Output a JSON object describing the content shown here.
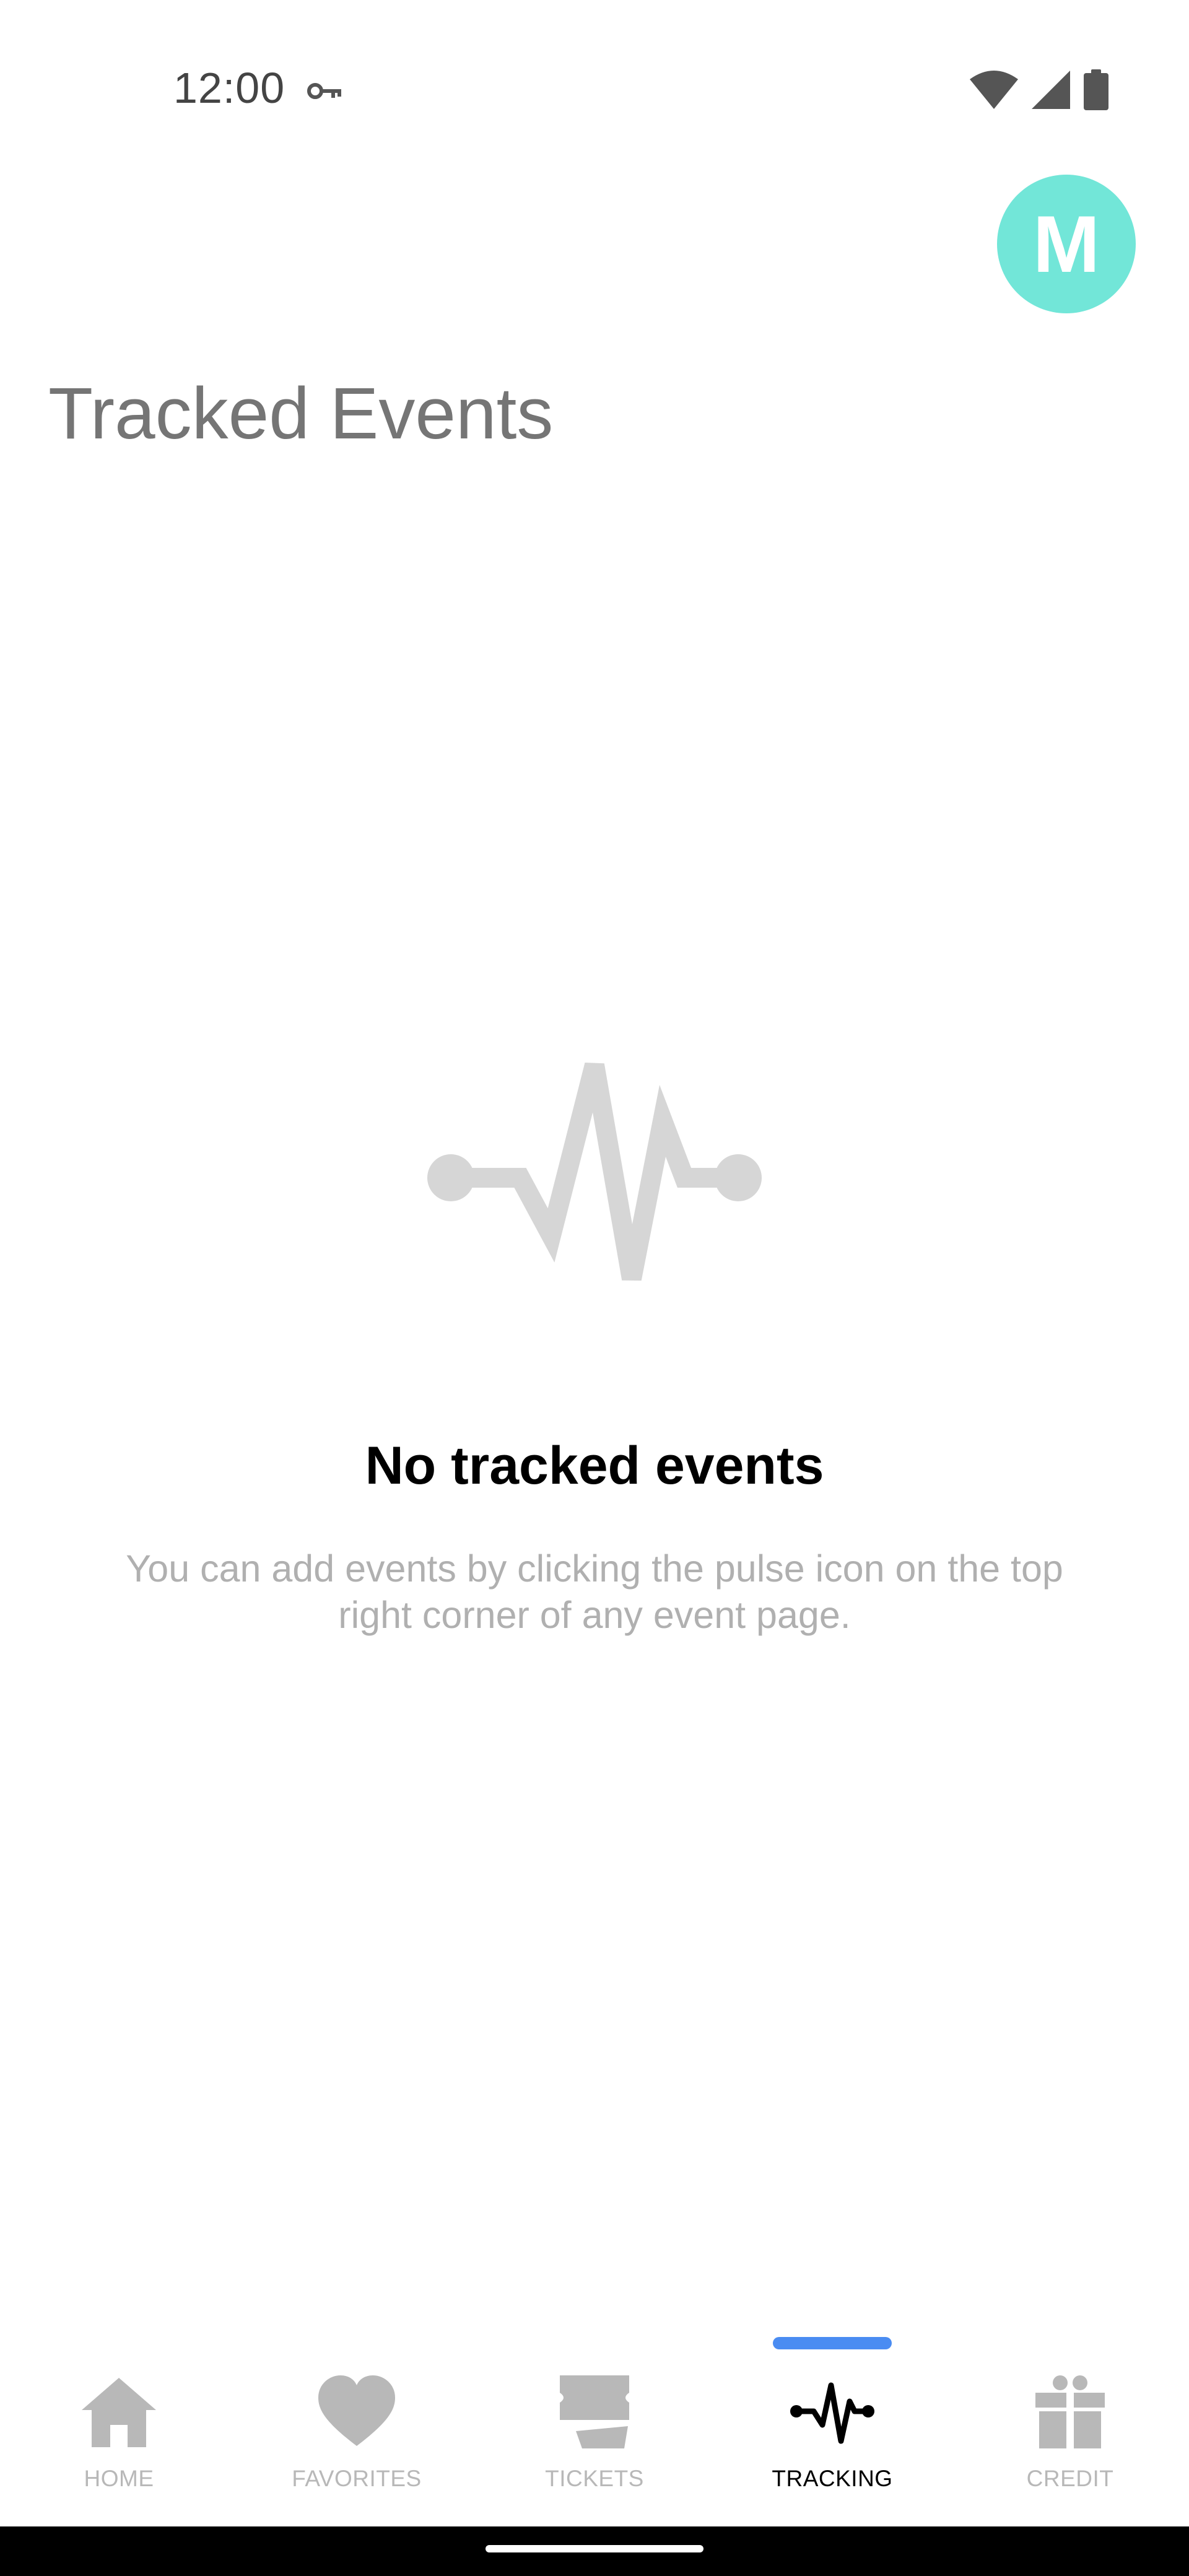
{
  "status_bar": {
    "time": "12:00",
    "icons": [
      "vpn-key-icon",
      "wifi-icon",
      "cellular-signal-icon",
      "battery-icon"
    ]
  },
  "header": {
    "avatar_letter": "M",
    "avatar_color": "#72e6d8",
    "title": "Tracked Events"
  },
  "empty_state": {
    "icon": "pulse-icon",
    "icon_color": "#d6d6d6",
    "title": "No tracked events",
    "message": "You can add events by clicking the pulse icon on the top right corner of any event page."
  },
  "bottom_nav": {
    "active_color": "#000000",
    "inactive_color": "#b8b8b8",
    "indicator_color": "#4a8cf2",
    "items": [
      {
        "label": "HOME",
        "icon": "home-icon",
        "active": false
      },
      {
        "label": "FAVORITES",
        "icon": "heart-icon",
        "active": false
      },
      {
        "label": "TICKETS",
        "icon": "ticket-icon",
        "active": false
      },
      {
        "label": "TRACKING",
        "icon": "pulse-icon",
        "active": true
      },
      {
        "label": "CREDIT",
        "icon": "gift-icon",
        "active": false
      }
    ]
  }
}
